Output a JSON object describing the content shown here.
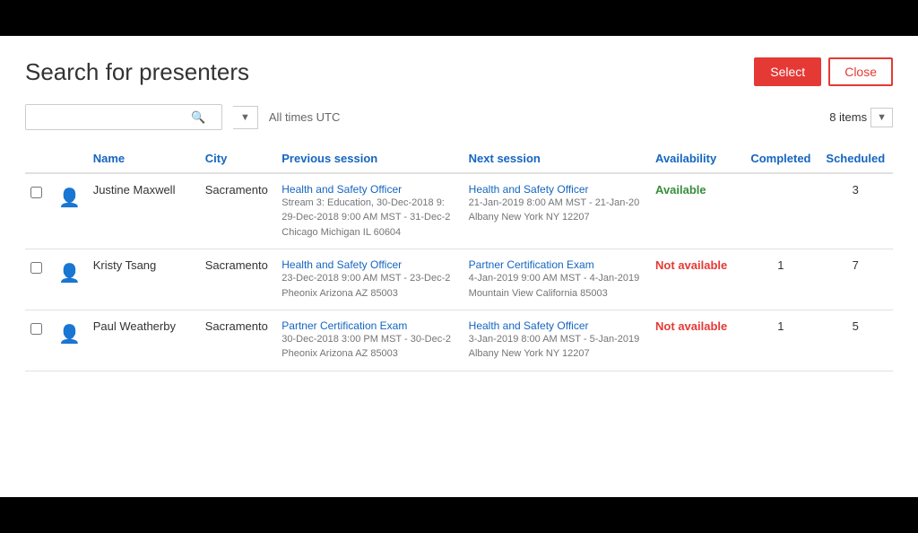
{
  "page": {
    "title": "Search for presenters",
    "buttons": {
      "select": "Select",
      "close": "Close"
    },
    "search": {
      "placeholder": "",
      "timezone": "All times UTC",
      "items_count": "8 items"
    },
    "table": {
      "columns": [
        {
          "key": "check",
          "label": ""
        },
        {
          "key": "avatar",
          "label": ""
        },
        {
          "key": "name",
          "label": "Name"
        },
        {
          "key": "city",
          "label": "City"
        },
        {
          "key": "previous_session",
          "label": "Previous session"
        },
        {
          "key": "next_session",
          "label": "Next session"
        },
        {
          "key": "availability",
          "label": "Availability"
        },
        {
          "key": "completed",
          "label": "Completed"
        },
        {
          "key": "scheduled",
          "label": "Scheduled"
        }
      ],
      "rows": [
        {
          "name": "Justine Maxwell",
          "city": "Sacramento",
          "prev_session_title": "Health and Safety Officer",
          "prev_session_detail1": "Stream 3: Education, 30-Dec-2018 9:",
          "prev_session_detail2": "29-Dec-2018 9:00 AM MST - 31-Dec-2",
          "prev_session_detail3": "Chicago Michigan IL 60604",
          "next_session_title": "Health and Safety Officer",
          "next_session_detail1": "21-Jan-2019 8:00 AM MST - 21-Jan-20",
          "next_session_detail2": "Albany New York NY 12207",
          "availability": "Available",
          "availability_class": "avail-yes",
          "completed": "",
          "scheduled": "3"
        },
        {
          "name": "Kristy Tsang",
          "city": "Sacramento",
          "prev_session_title": "Health and Safety Officer",
          "prev_session_detail1": "23-Dec-2018 9:00 AM MST - 23-Dec-2",
          "prev_session_detail2": "",
          "prev_session_detail3": "Pheonix Arizona AZ 85003",
          "next_session_title": "Partner Certification Exam",
          "next_session_detail1": "4-Jan-2019 9:00 AM MST - 4-Jan-2019",
          "next_session_detail2": "Mountain View California 85003",
          "availability": "Not available",
          "availability_class": "avail-no",
          "completed": "1",
          "scheduled": "7"
        },
        {
          "name": "Paul Weatherby",
          "city": "Sacramento",
          "prev_session_title": "Partner Certification Exam",
          "prev_session_detail1": "30-Dec-2018 3:00 PM MST - 30-Dec-2",
          "prev_session_detail2": "",
          "prev_session_detail3": "Pheonix Arizona AZ 85003",
          "next_session_title": "Health and Safety Officer",
          "next_session_detail1": "3-Jan-2019 8:00 AM MST - 5-Jan-2019",
          "next_session_detail2": "Albany New York NY 12207",
          "availability": "Not available",
          "availability_class": "avail-no",
          "completed": "1",
          "scheduled": "5"
        }
      ]
    }
  }
}
